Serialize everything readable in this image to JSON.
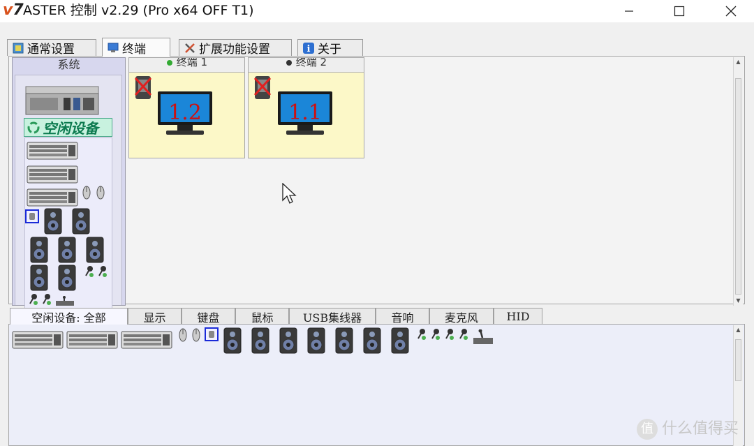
{
  "window": {
    "logo_v": "v",
    "logo_num": "7",
    "title": "ASTER 控制 v2.29 (Pro x64 OFF T1)",
    "minimize_icon": "minimize-icon",
    "maximize_icon": "maximize-icon",
    "close_icon": "close-icon"
  },
  "main_tabs": [
    {
      "label": "通常设置",
      "icon": "settings-icon",
      "active": false
    },
    {
      "label": "终端",
      "icon": "terminal-icon",
      "active": true
    },
    {
      "label": "扩展功能设置",
      "icon": "tools-icon",
      "active": false
    },
    {
      "label": "关于",
      "icon": "info-icon",
      "active": false
    }
  ],
  "system_panel": {
    "label": "系统",
    "idle_devices_label": "空闲设备"
  },
  "terminals": [
    {
      "label": "终端 1",
      "status_color": "#33aa33",
      "monitor_text": "1.2"
    },
    {
      "label": "终端 2",
      "status_color": "#333333",
      "monitor_text": "1.1"
    }
  ],
  "bottom_tabs": [
    {
      "label": "空闲设备: 全部",
      "active": true
    },
    {
      "label": "显示",
      "active": false
    },
    {
      "label": "键盘",
      "active": false
    },
    {
      "label": "鼠标",
      "active": false
    },
    {
      "label": "USB集线器",
      "active": false
    },
    {
      "label": "音响",
      "active": false
    },
    {
      "label": "麦克风",
      "active": false
    },
    {
      "label": "HID",
      "active": false
    }
  ],
  "watermark": {
    "text": "什么值得买"
  },
  "colors": {
    "accent": "#d9531e",
    "terminal_bg": "#fcf8c8",
    "idle_badge_bg": "#c8f2df",
    "idle_badge_text": "#0b7a4e",
    "monitor_number": "#cc1111"
  }
}
